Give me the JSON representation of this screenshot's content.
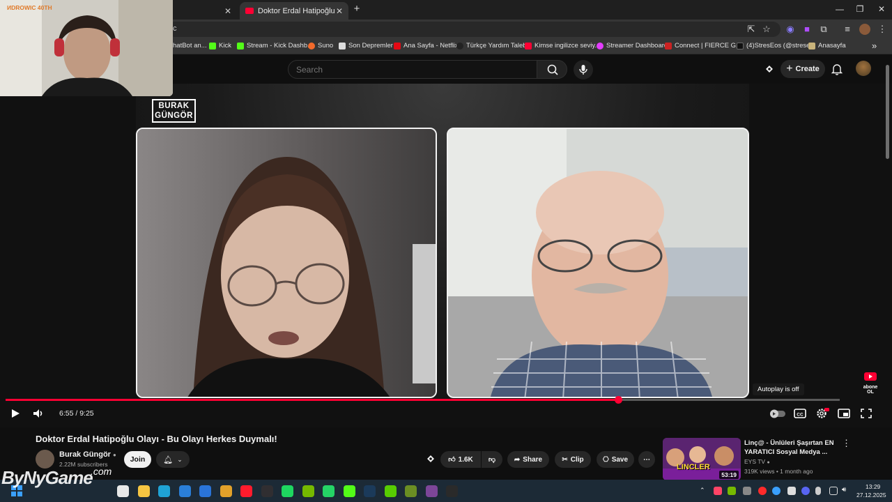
{
  "webcam": {
    "label": "ИDROWIC 40TH"
  },
  "browser": {
    "tabs": [
      {
        "title": "",
        "active": false
      },
      {
        "title": "Doktor Erdal Hatipoğlu Olayı -",
        "active": true
      }
    ],
    "new_tab": "+",
    "window_controls": {
      "minimize": "—",
      "restore": "❐",
      "close": "✕"
    },
    "omnibox_text": "c",
    "bookmarks": [
      {
        "label": "hatBot an...",
        "color": "#555555"
      },
      {
        "label": "Kick",
        "color": "#53fc18"
      },
      {
        "label": "Stream - Kick Dashb...",
        "color": "#53fc18"
      },
      {
        "label": "Suno",
        "color": "#f36a2b"
      },
      {
        "label": "Son Depremler",
        "color": "#dddddd"
      },
      {
        "label": "Ana Sayfa - Netflix",
        "color": "#e50914"
      },
      {
        "label": "Türkçe Yardım Talebi",
        "color": "#222222"
      },
      {
        "label": "Kimse ingilizce seviy...",
        "color": "#ff0033"
      },
      {
        "label": "Streamer Dashboard",
        "color": "#e33cff"
      },
      {
        "label": "Connect | FIERCE G...",
        "color": "#cc2222"
      },
      {
        "label": "(4)StresEos (@strese...",
        "color": "#111111"
      },
      {
        "label": "Anasayfa",
        "color": "#c8b37a"
      }
    ],
    "bookmarks_more": "»"
  },
  "youtube": {
    "search_placeholder": "Search",
    "create_label": "Create",
    "create_plus": "+"
  },
  "player": {
    "channel_logo_line1": "BURAK",
    "channel_logo_line2": "GÜNGÖR",
    "time_display": "6:55 / 9:25",
    "progress_fraction": 0.7345,
    "autoplay_tooltip": "Autoplay is off",
    "corner_badge": "abone OL"
  },
  "video": {
    "title": "Doktor Erdal Hatipoğlu Olayı - Bu Olayı Herkes Duymalı!",
    "channel_name": "Burak Güngör",
    "subscribers": "2.22M subscribers",
    "join_label": "Join",
    "like_count": "1.6K",
    "share_label": "Share",
    "clip_label": "Clip",
    "save_label": "Save",
    "more_label": "⋯"
  },
  "recommended": {
    "title": "Linç@ - Ünlüleri Şaşırtan EN YARATICI Sosyal Medya ...",
    "channel": "EYS TV",
    "meta": "319K views • 1 month ago",
    "duration": "53:19",
    "thumb_banner": "LINCLER"
  },
  "watermark": {
    "main": "ByNyGame",
    "suffix": ".com"
  },
  "taskbar": {
    "time": "13:29",
    "date": "27.12.2025",
    "apps": [
      {
        "name": "search",
        "color": "#e8e8e8"
      },
      {
        "name": "file-explorer",
        "color": "#f5c542"
      },
      {
        "name": "edge",
        "color": "#1fa3d6"
      },
      {
        "name": "store",
        "color": "#2a7fd8"
      },
      {
        "name": "outlook",
        "color": "#2a74d8"
      },
      {
        "name": "chrome",
        "color": "#e2a12a"
      },
      {
        "name": "opera",
        "color": "#ff1b2d"
      },
      {
        "name": "obs",
        "color": "#302e31"
      },
      {
        "name": "spotify",
        "color": "#1ed760"
      },
      {
        "name": "nvidia",
        "color": "#76b900"
      },
      {
        "name": "whatsapp",
        "color": "#25d366"
      },
      {
        "name": "kick",
        "color": "#53fc18"
      },
      {
        "name": "steam",
        "color": "#1b3a5a"
      },
      {
        "name": "duolingo",
        "color": "#58cc02"
      },
      {
        "name": "minecraft",
        "color": "#6b8e23"
      },
      {
        "name": "tor",
        "color": "#7d4698"
      },
      {
        "name": "epic",
        "color": "#2a2a2a"
      }
    ]
  }
}
